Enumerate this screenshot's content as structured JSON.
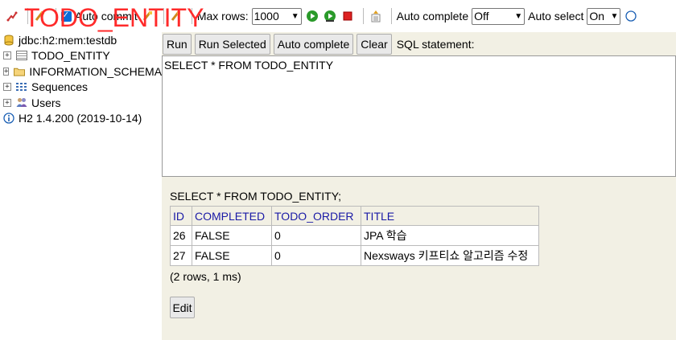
{
  "overlay_title": "TODO_ENTITY",
  "toolbar": {
    "auto_commit_label": "Auto commit",
    "max_rows_label": "Max rows:",
    "max_rows_value": "1000",
    "auto_complete_label": "Auto complete",
    "auto_complete_value": "Off",
    "auto_select_label": "Auto select",
    "auto_select_value": "On",
    "help_glyph": "?"
  },
  "tree": {
    "connection": "jdbc:h2:mem:testdb",
    "items": [
      {
        "label": "TODO_ENTITY",
        "icon": "table-icon"
      },
      {
        "label": "INFORMATION_SCHEMA",
        "icon": "folder-icon"
      },
      {
        "label": "Sequences",
        "icon": "sequences-icon"
      },
      {
        "label": "Users",
        "icon": "users-icon"
      }
    ],
    "version": "H2 1.4.200 (2019-10-14)"
  },
  "buttons": {
    "run": "Run",
    "run_selected": "Run Selected",
    "auto_complete": "Auto complete",
    "clear": "Clear",
    "sql_statement_label": "SQL statement:"
  },
  "editor": {
    "sql": "SELECT * FROM TODO_ENTITY"
  },
  "result": {
    "sql": "SELECT * FROM TODO_ENTITY;",
    "columns": [
      "ID",
      "COMPLETED",
      "TODO_ORDER",
      "TITLE"
    ],
    "rows": [
      [
        "26",
        "FALSE",
        "0",
        "JPA 학습"
      ],
      [
        "27",
        "FALSE",
        "0",
        "Nexsways 키프티쇼 알고리즘 수정"
      ]
    ],
    "summary": "(2 rows, 1 ms)",
    "edit_label": "Edit"
  },
  "colors": {
    "panel_bg": "#f2f0e4",
    "header_text": "#1a1aa6",
    "overlay_red": "#ff2a2a"
  }
}
